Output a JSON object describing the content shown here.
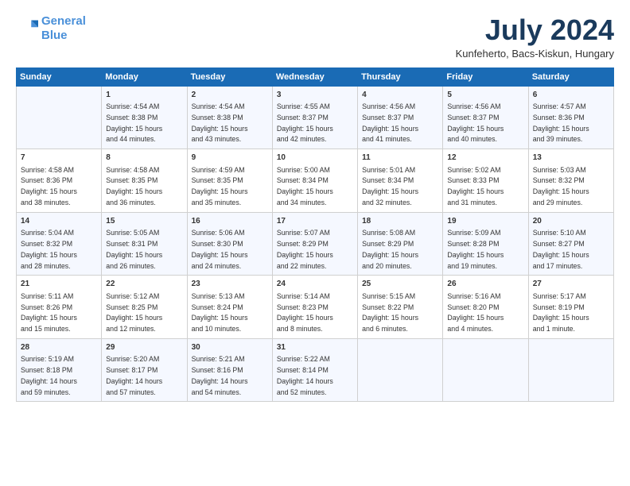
{
  "header": {
    "logo_line1": "General",
    "logo_line2": "Blue",
    "month": "July 2024",
    "location": "Kunfeherto, Bacs-Kiskun, Hungary"
  },
  "days_of_week": [
    "Sunday",
    "Monday",
    "Tuesday",
    "Wednesday",
    "Thursday",
    "Friday",
    "Saturday"
  ],
  "weeks": [
    [
      {
        "num": "",
        "info": ""
      },
      {
        "num": "1",
        "info": "Sunrise: 4:54 AM\nSunset: 8:38 PM\nDaylight: 15 hours\nand 44 minutes."
      },
      {
        "num": "2",
        "info": "Sunrise: 4:54 AM\nSunset: 8:38 PM\nDaylight: 15 hours\nand 43 minutes."
      },
      {
        "num": "3",
        "info": "Sunrise: 4:55 AM\nSunset: 8:37 PM\nDaylight: 15 hours\nand 42 minutes."
      },
      {
        "num": "4",
        "info": "Sunrise: 4:56 AM\nSunset: 8:37 PM\nDaylight: 15 hours\nand 41 minutes."
      },
      {
        "num": "5",
        "info": "Sunrise: 4:56 AM\nSunset: 8:37 PM\nDaylight: 15 hours\nand 40 minutes."
      },
      {
        "num": "6",
        "info": "Sunrise: 4:57 AM\nSunset: 8:36 PM\nDaylight: 15 hours\nand 39 minutes."
      }
    ],
    [
      {
        "num": "7",
        "info": "Sunrise: 4:58 AM\nSunset: 8:36 PM\nDaylight: 15 hours\nand 38 minutes."
      },
      {
        "num": "8",
        "info": "Sunrise: 4:58 AM\nSunset: 8:35 PM\nDaylight: 15 hours\nand 36 minutes."
      },
      {
        "num": "9",
        "info": "Sunrise: 4:59 AM\nSunset: 8:35 PM\nDaylight: 15 hours\nand 35 minutes."
      },
      {
        "num": "10",
        "info": "Sunrise: 5:00 AM\nSunset: 8:34 PM\nDaylight: 15 hours\nand 34 minutes."
      },
      {
        "num": "11",
        "info": "Sunrise: 5:01 AM\nSunset: 8:34 PM\nDaylight: 15 hours\nand 32 minutes."
      },
      {
        "num": "12",
        "info": "Sunrise: 5:02 AM\nSunset: 8:33 PM\nDaylight: 15 hours\nand 31 minutes."
      },
      {
        "num": "13",
        "info": "Sunrise: 5:03 AM\nSunset: 8:32 PM\nDaylight: 15 hours\nand 29 minutes."
      }
    ],
    [
      {
        "num": "14",
        "info": "Sunrise: 5:04 AM\nSunset: 8:32 PM\nDaylight: 15 hours\nand 28 minutes."
      },
      {
        "num": "15",
        "info": "Sunrise: 5:05 AM\nSunset: 8:31 PM\nDaylight: 15 hours\nand 26 minutes."
      },
      {
        "num": "16",
        "info": "Sunrise: 5:06 AM\nSunset: 8:30 PM\nDaylight: 15 hours\nand 24 minutes."
      },
      {
        "num": "17",
        "info": "Sunrise: 5:07 AM\nSunset: 8:29 PM\nDaylight: 15 hours\nand 22 minutes."
      },
      {
        "num": "18",
        "info": "Sunrise: 5:08 AM\nSunset: 8:29 PM\nDaylight: 15 hours\nand 20 minutes."
      },
      {
        "num": "19",
        "info": "Sunrise: 5:09 AM\nSunset: 8:28 PM\nDaylight: 15 hours\nand 19 minutes."
      },
      {
        "num": "20",
        "info": "Sunrise: 5:10 AM\nSunset: 8:27 PM\nDaylight: 15 hours\nand 17 minutes."
      }
    ],
    [
      {
        "num": "21",
        "info": "Sunrise: 5:11 AM\nSunset: 8:26 PM\nDaylight: 15 hours\nand 15 minutes."
      },
      {
        "num": "22",
        "info": "Sunrise: 5:12 AM\nSunset: 8:25 PM\nDaylight: 15 hours\nand 12 minutes."
      },
      {
        "num": "23",
        "info": "Sunrise: 5:13 AM\nSunset: 8:24 PM\nDaylight: 15 hours\nand 10 minutes."
      },
      {
        "num": "24",
        "info": "Sunrise: 5:14 AM\nSunset: 8:23 PM\nDaylight: 15 hours\nand 8 minutes."
      },
      {
        "num": "25",
        "info": "Sunrise: 5:15 AM\nSunset: 8:22 PM\nDaylight: 15 hours\nand 6 minutes."
      },
      {
        "num": "26",
        "info": "Sunrise: 5:16 AM\nSunset: 8:20 PM\nDaylight: 15 hours\nand 4 minutes."
      },
      {
        "num": "27",
        "info": "Sunrise: 5:17 AM\nSunset: 8:19 PM\nDaylight: 15 hours\nand 1 minute."
      }
    ],
    [
      {
        "num": "28",
        "info": "Sunrise: 5:19 AM\nSunset: 8:18 PM\nDaylight: 14 hours\nand 59 minutes."
      },
      {
        "num": "29",
        "info": "Sunrise: 5:20 AM\nSunset: 8:17 PM\nDaylight: 14 hours\nand 57 minutes."
      },
      {
        "num": "30",
        "info": "Sunrise: 5:21 AM\nSunset: 8:16 PM\nDaylight: 14 hours\nand 54 minutes."
      },
      {
        "num": "31",
        "info": "Sunrise: 5:22 AM\nSunset: 8:14 PM\nDaylight: 14 hours\nand 52 minutes."
      },
      {
        "num": "",
        "info": ""
      },
      {
        "num": "",
        "info": ""
      },
      {
        "num": "",
        "info": ""
      }
    ]
  ]
}
